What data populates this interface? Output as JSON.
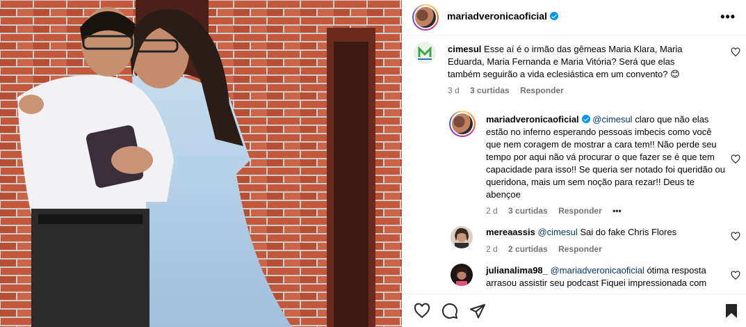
{
  "post": {
    "username": "mariadveronicaoficial",
    "more_icon": "more-horizontal-icon"
  },
  "comments": [
    {
      "username": "cimesul",
      "text": "Esse aí é o irmão das gêmeas Maria Klara, Maria Eduarda, Maria Fernanda e Maria Vitória? Será que elas também seguirão a vida eclesiástica em um convento? 😊",
      "time": "3 d",
      "likes": "3 curtidas",
      "reply": "Responder"
    },
    {
      "username": "mariadveronicaoficial",
      "mention": "@cimesul",
      "text": "claro que não elas estão no inferno esperando pessoas imbecis como você que nem coragem de mostrar a cara tem!! Não perde seu tempo por aqui não vá procurar o que fazer se é que tem capacidade para isso!! Se queria ser notado foi queridão ou queridona, mais um sem noção para rezar!! Deus te abençoe",
      "time": "2 d",
      "likes": "3 curtidas",
      "reply": "Responder",
      "more": "•••"
    },
    {
      "username": "mereaassis",
      "mention": "@cimesul",
      "text": "Sai do fake Chris Flores",
      "time": "2 d",
      "likes": "2 curtidas",
      "reply": "Responder"
    },
    {
      "username": "julianalima98_",
      "mention": "@mariadveronicaoficial",
      "text": "ótima resposta arrasou assistir seu podcast Fiquei impressionada com"
    }
  ],
  "actions": {
    "like_icon": "heart-icon",
    "comment_icon": "comment-icon",
    "share_icon": "share-icon",
    "save_icon": "bookmark-icon"
  },
  "colors": {
    "link": "#00376b",
    "verified": "#0095f6",
    "meta": "#737373"
  }
}
